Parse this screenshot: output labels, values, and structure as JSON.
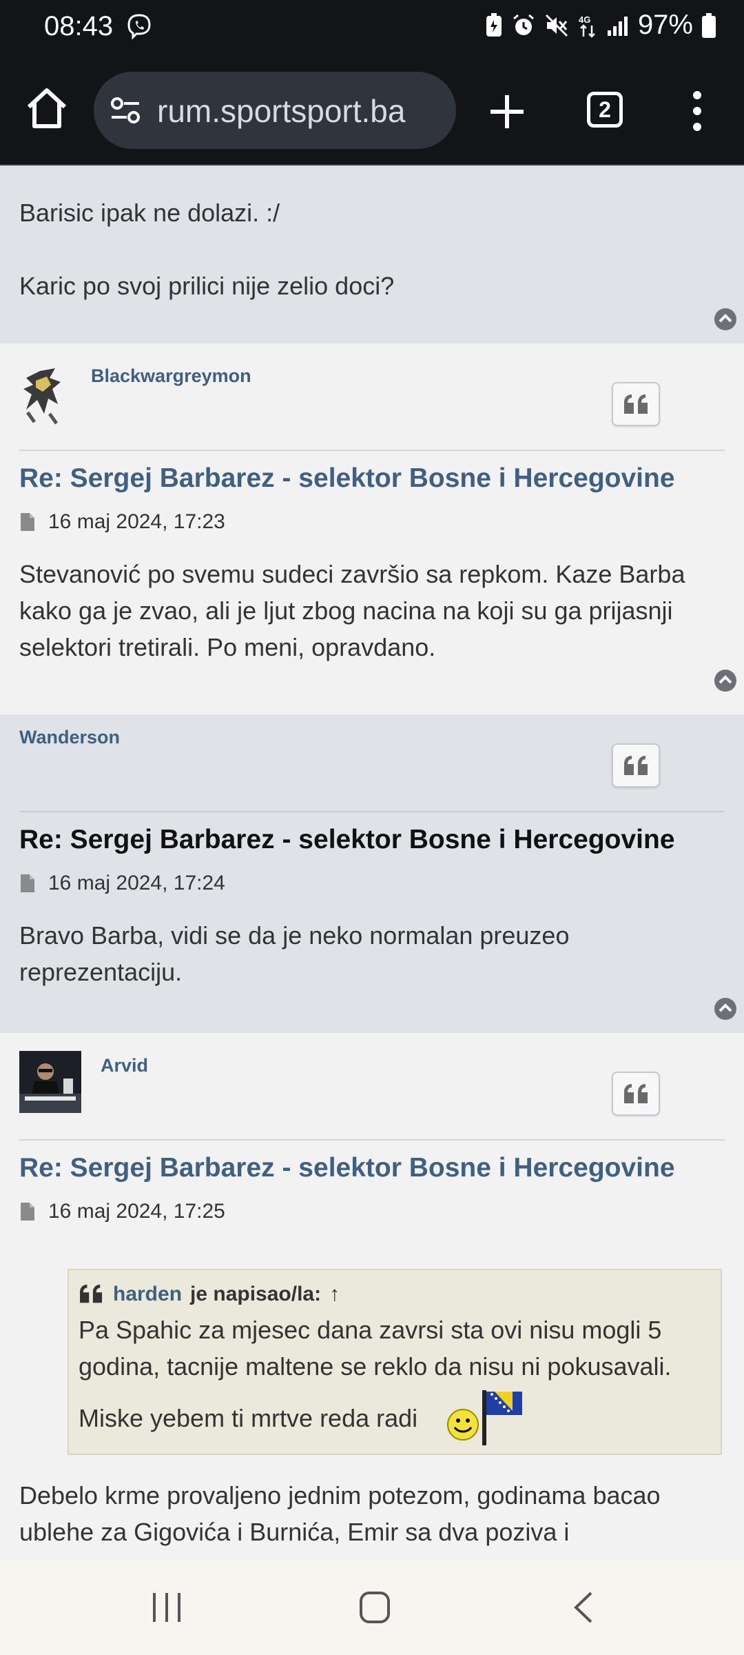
{
  "status": {
    "time": "08:43",
    "battery": "97%"
  },
  "browser": {
    "url": "rum.sportsport.ba",
    "tab_count": "2"
  },
  "prev_post": {
    "line1": "Barisic ipak ne dolazi. :/",
    "line2": "Karic po svoj prilici nije zelio doci?"
  },
  "posts": [
    {
      "author": "Blackwargreymon",
      "title": "Re: Sergej Barbarez - selektor Bosne i Hercegovine",
      "date": "16 maj 2024, 17:23",
      "body": "Stevanović po svemu sudeci završio sa repkom. Kaze Barba kako ga je zvao, ali je ljut zbog nacina na koji su ga prijasnji selektori tretirali. Po meni, opravdano."
    },
    {
      "author": "Wanderson",
      "title": "Re: Sergej Barbarez - selektor Bosne i Hercegovine",
      "date": "16 maj 2024, 17:24",
      "body": "Bravo Barba, vidi se da je neko normalan preuzeo reprezentaciju."
    },
    {
      "author": "Arvid",
      "title": "Re: Sergej Barbarez - selektor Bosne i Hercegovine",
      "date": "16 maj 2024, 17:25",
      "quote": {
        "user": "harden",
        "wrote": "je napisao/la:",
        "arrow": "↑",
        "text": "Pa Spahic za mjesec dana zavrsi sta ovi nisu mogli 5 godina, tacnije maltene se reklo da nisu ni pokusavali.",
        "text2": "Miske yebem ti mrtve reda radi"
      },
      "body": "Debelo krme provaljeno jednim potezom, godinama bacao ublehe za Gigovića i Burnića, Emir sa dva poziva i"
    }
  ],
  "colors": {
    "link": "#3f6080",
    "post_alt_bg": "#dfe2e6",
    "post_bg": "#f2f2f2",
    "toolbar_bg": "#121418"
  }
}
